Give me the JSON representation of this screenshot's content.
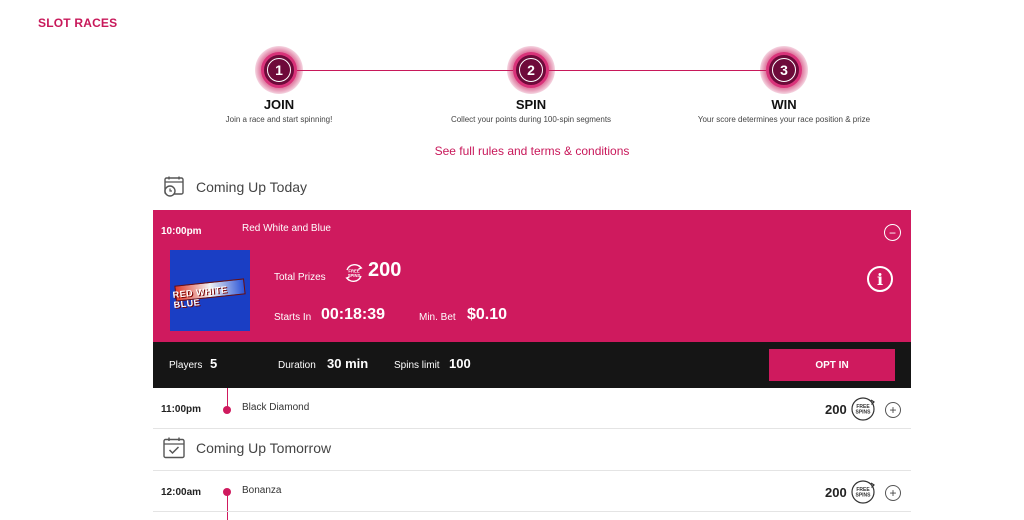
{
  "brand": "SLOT RACES",
  "steps": [
    {
      "number": "1",
      "title": "JOIN",
      "desc": "Join a race and start spinning!"
    },
    {
      "number": "2",
      "title": "SPIN",
      "desc": "Collect your points during 100-spin segments"
    },
    {
      "number": "3",
      "title": "WIN",
      "desc": "Your score determines your race position & prize"
    }
  ],
  "rules_link": "See full rules and terms & conditions",
  "sections": {
    "today": "Coming Up Today",
    "tomorrow": "Coming Up Tomorrow"
  },
  "active_race": {
    "time": "10:00pm",
    "name": "Red White and Blue",
    "thumb_text": "RED WHITE BLUE",
    "total_prizes_label": "Total Prizes",
    "total_prizes_value": "200",
    "starts_in_label": "Starts In",
    "starts_in_value": "00:18:39",
    "min_bet_label": "Min. Bet",
    "min_bet_value": "$0.10",
    "collapse_symbol": "−",
    "info_symbol": "i"
  },
  "free_spins_badge": "FREE SPINS",
  "race_bar": {
    "players_label": "Players",
    "players_value": "5",
    "duration_label": "Duration",
    "duration_value": "30 min",
    "spins_limit_label": "Spins limit",
    "spins_limit_value": "100",
    "opt_in_label": "OPT IN"
  },
  "upcoming_races": [
    {
      "time": "11:00pm",
      "name": "Black Diamond",
      "prize": "200",
      "expand_symbol": "+"
    },
    {
      "time": "12:00am",
      "name": "Bonanza",
      "prize": "200",
      "expand_symbol": "+"
    }
  ],
  "colors": {
    "accent": "#cf1a5e",
    "dark_bar": "#151515",
    "step_circle": "#6e0a3a"
  }
}
